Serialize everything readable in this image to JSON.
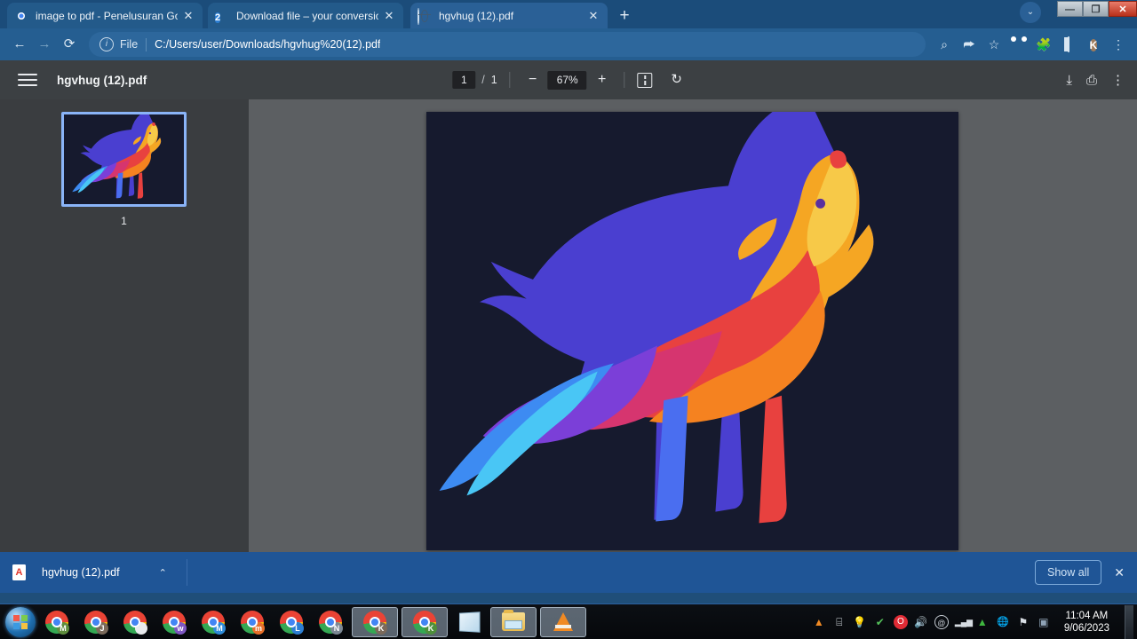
{
  "window": {
    "controls": {
      "minimize": "—",
      "restore": "❐",
      "close": "✕"
    },
    "tab_list_chevron": "⌄"
  },
  "tabs": [
    {
      "title": "image to pdf - Penelusuran Goog",
      "favicon": "chrome-icon",
      "active": false,
      "close": "✕"
    },
    {
      "title": "Download file – your conversion",
      "favicon": "number-2-icon",
      "favicon_text": "2",
      "active": false,
      "close": "✕"
    },
    {
      "title": "hgvhug (12).pdf",
      "favicon": "globe-icon",
      "active": true,
      "close": "✕"
    }
  ],
  "new_tab_label": "+",
  "toolbar": {
    "back": "←",
    "forward": "→",
    "reload": "⟳",
    "omnibox": {
      "info_icon": "i",
      "scheme_label": "File",
      "url": "C:/Users/user/Downloads/hgvhug%20(12).pdf"
    },
    "icons": [
      {
        "name": "search-icon",
        "glyph": "⌕"
      },
      {
        "name": "share-icon",
        "glyph": "⮫"
      },
      {
        "name": "bookmark-star-icon",
        "glyph": "☆"
      },
      {
        "name": "extension-dark-icon",
        "glyph": ""
      },
      {
        "name": "extensions-puzzle-icon",
        "glyph": "🧩"
      },
      {
        "name": "side-panel-icon",
        "glyph": ""
      },
      {
        "name": "profile-avatar",
        "glyph": "K"
      },
      {
        "name": "chrome-menu-icon",
        "glyph": "⋮"
      }
    ]
  },
  "pdf_viewer": {
    "menu_icon": "hamburger-icon",
    "document_title": "hgvhug (12).pdf",
    "page_current": "1",
    "page_separator": "/",
    "page_total": "1",
    "zoom_out": "−",
    "zoom_level": "67%",
    "zoom_in": "+",
    "fit_label": "fit-to-page-icon",
    "rotate_label": "rotate-icon",
    "rotate_glyph": "↻",
    "download_glyph": "⤓",
    "print_glyph": "⎙",
    "more_glyph": "⋮",
    "thumbnail_page_number": "1",
    "page_background": "#161a2e"
  },
  "download_shelf": {
    "file_name": "hgvhug (12).pdf",
    "file_icon": "pdf-file-icon",
    "expand_chevron": "⌃",
    "show_all_label": "Show all",
    "close_label": "✕"
  },
  "taskbar": {
    "start_label": "start-orb",
    "items": [
      {
        "name": "chrome-window-m1",
        "badge": "M",
        "badge_color": "#5f8d3e",
        "open": false
      },
      {
        "name": "chrome-window-j",
        "badge": "J",
        "badge_color": "#7b6a5b",
        "open": false
      },
      {
        "name": "chrome-window-blank",
        "badge": "",
        "badge_color": "#e8eaed",
        "open": false
      },
      {
        "name": "chrome-window-w",
        "badge": "w",
        "badge_color": "#7e57c2",
        "open": false
      },
      {
        "name": "chrome-window-m2",
        "badge": "M",
        "badge_color": "#2e8bd8",
        "open": false
      },
      {
        "name": "chrome-window-m3",
        "badge": "m",
        "badge_color": "#e8702a",
        "open": false
      },
      {
        "name": "chrome-window-l",
        "badge": "L",
        "badge_color": "#2d7fd3",
        "open": false
      },
      {
        "name": "chrome-window-n",
        "badge": "N",
        "badge_color": "#7c8894",
        "open": false
      },
      {
        "name": "chrome-window-k1",
        "badge": "K",
        "badge_color": "#7b6a5b",
        "open": true
      },
      {
        "name": "chrome-window-k2",
        "badge": "K",
        "badge_color": "#4e8f3b",
        "open": true
      },
      {
        "name": "notepad-window",
        "badge": "",
        "badge_color": "",
        "open": false
      },
      {
        "name": "file-explorer-window",
        "badge": "",
        "badge_color": "",
        "open": true
      },
      {
        "name": "vlc-player-window",
        "badge": "",
        "badge_color": "",
        "open": true
      }
    ],
    "tray_icons": [
      {
        "name": "vlc-tray-icon",
        "glyph": "▲",
        "color": "#f08a24"
      },
      {
        "name": "device-tray-icon",
        "glyph": "⌸",
        "color": "#dfe5ea"
      },
      {
        "name": "idea-tray-icon",
        "glyph": "💡",
        "color": "#c9cfd6"
      },
      {
        "name": "update-ready-tray-icon",
        "glyph": "✔",
        "color": "#54c05a"
      },
      {
        "name": "opera-tray-icon",
        "glyph": "O",
        "color": "#e02b35"
      },
      {
        "name": "volume-tray-icon",
        "glyph": "🔊",
        "color": "#e4e9ee"
      },
      {
        "name": "at-sign-tray-icon",
        "glyph": "@",
        "color": "#c6ccd3"
      },
      {
        "name": "network-signal-tray-icon",
        "glyph": "▂▄▆",
        "color": "#d6dce2"
      },
      {
        "name": "green-triangle-tray-icon",
        "glyph": "▲",
        "color": "#3fb53f"
      },
      {
        "name": "globe-tray-icon",
        "glyph": "🌐",
        "color": "#9aa6b0"
      },
      {
        "name": "flag-error-tray-icon",
        "glyph": "⚑",
        "color": "#d8dee4"
      },
      {
        "name": "misc-tray-icon",
        "glyph": "▣",
        "color": "#8fa3b6"
      }
    ],
    "clock_time": "11:04 AM",
    "clock_date": "9/06/2023"
  }
}
